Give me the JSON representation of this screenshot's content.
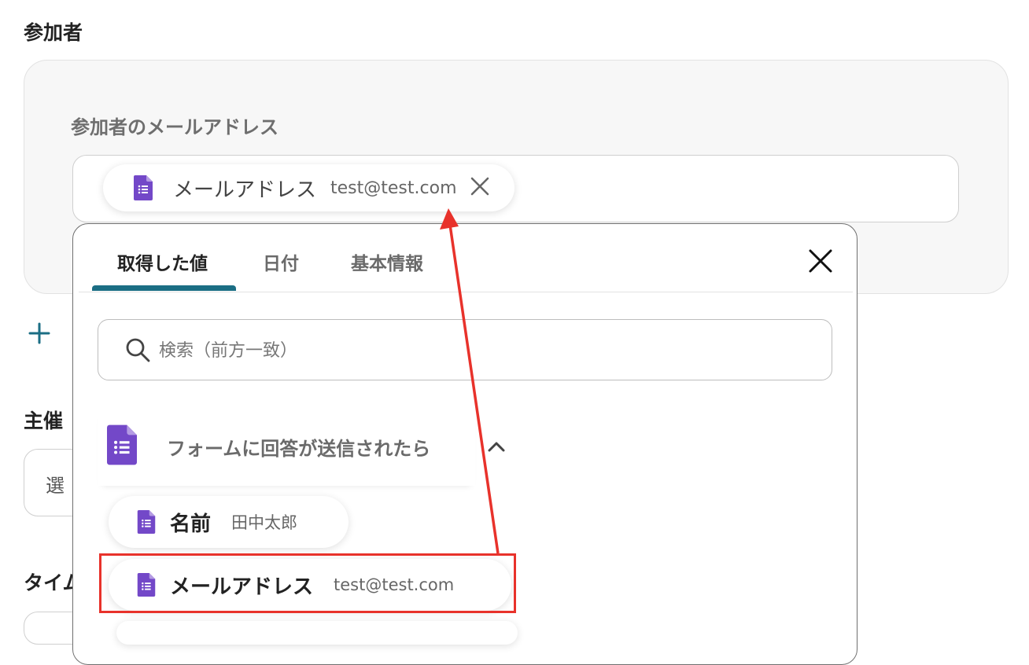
{
  "attendees": {
    "section_title": "参加者",
    "field_label": "参加者のメールアドレス",
    "chip": {
      "name": "メールアドレス",
      "value": "test@test.com"
    }
  },
  "host": {
    "section_title_partial": "主催",
    "select_placeholder_partial": "選"
  },
  "timezone": {
    "section_title_partial": "タイム"
  },
  "dropdown": {
    "tabs": [
      {
        "label": "取得した値",
        "active": true
      },
      {
        "label": "日付",
        "active": false
      },
      {
        "label": "基本情報",
        "active": false
      }
    ],
    "search_placeholder": "検索（前方一致）",
    "group": {
      "title": "フォームに回答が送信されたら",
      "items": [
        {
          "name": "名前",
          "value": "田中太郎"
        },
        {
          "name": "メールアドレス",
          "value": "test@test.com"
        }
      ]
    }
  },
  "colors": {
    "accent": "#1b6e84",
    "forms_purple": "#7348c8",
    "annotation_red": "#e8322b"
  },
  "icons": [
    "google-forms-icon",
    "close-icon",
    "plus-icon",
    "search-icon",
    "chevron-up-icon"
  ]
}
